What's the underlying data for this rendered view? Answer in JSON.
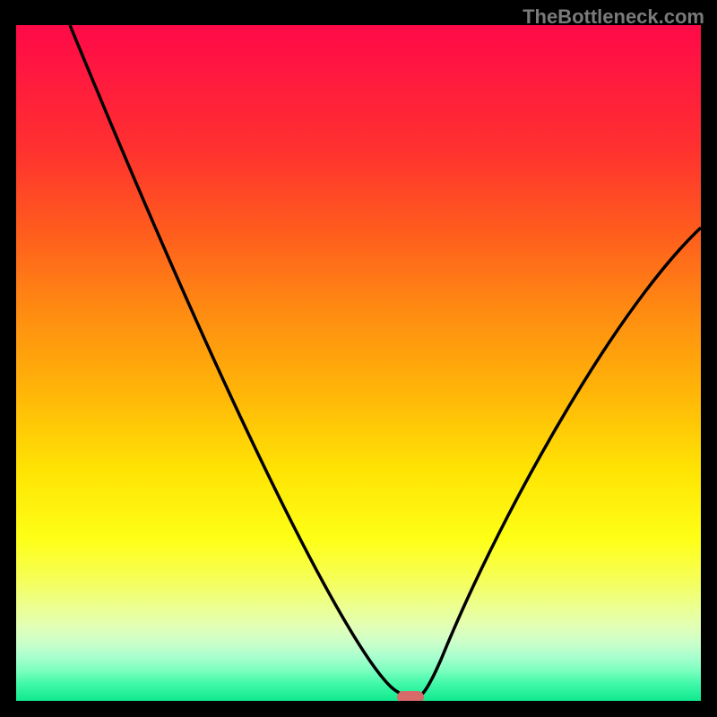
{
  "watermark": {
    "text": "TheBottleneck.com"
  },
  "chart_data": {
    "type": "line",
    "title": "",
    "xlabel": "",
    "ylabel": "",
    "x": [
      0.0,
      0.05,
      0.1,
      0.15,
      0.2,
      0.25,
      0.3,
      0.35,
      0.4,
      0.45,
      0.5,
      0.55,
      0.58,
      0.6,
      0.65,
      0.7,
      0.75,
      0.8,
      0.85,
      0.9,
      0.95,
      1.0
    ],
    "values": [
      1.0,
      0.913,
      0.826,
      0.738,
      0.651,
      0.563,
      0.476,
      0.388,
      0.296,
      0.197,
      0.093,
      0.01,
      0.0,
      0.024,
      0.147,
      0.252,
      0.346,
      0.432,
      0.511,
      0.581,
      0.64,
      0.693
    ],
    "xlim": [
      0,
      1
    ],
    "ylim": [
      0,
      1
    ],
    "marker": {
      "x": 0.573,
      "y": 0.003
    },
    "background": "red-yellow-green vertical gradient",
    "series_color": "#000000"
  }
}
